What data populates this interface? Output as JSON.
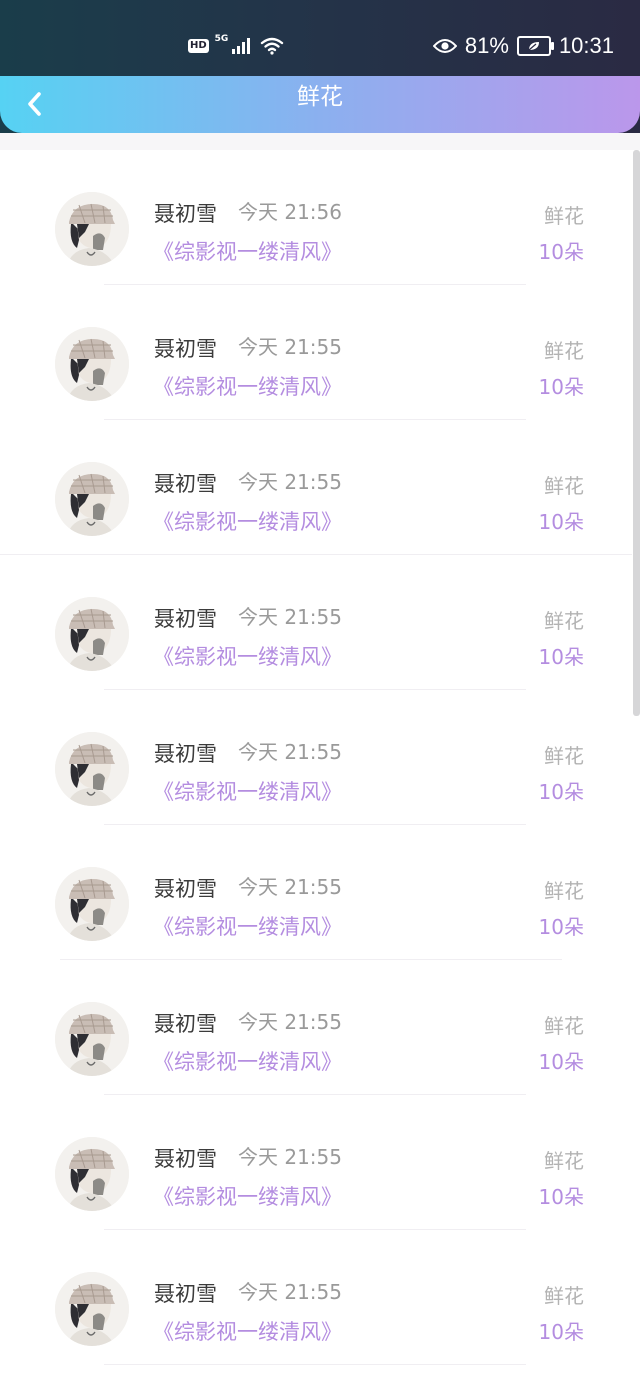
{
  "status_bar": {
    "hd_label": "HD",
    "network_label": "5G",
    "battery_percent": "81%",
    "time": "10:31",
    "icons": [
      "hd-icon",
      "signal-icon",
      "wifi-icon",
      "eye-icon",
      "battery-icon"
    ]
  },
  "header": {
    "title": "鲜花",
    "back_icon": "chevron-left-icon"
  },
  "colors": {
    "header_gradient_start": "#56d2f3",
    "header_gradient_end": "#bb97eb",
    "accent_purple": "#b48de0",
    "muted_gray": "#9a9a9a"
  },
  "records": [
    {
      "name": "聂初雪",
      "time": "今天 21:56",
      "work": "《综影视一缕清风》",
      "gift_type": "鲜花",
      "count": "10朵"
    },
    {
      "name": "聂初雪",
      "time": "今天 21:55",
      "work": "《综影视一缕清风》",
      "gift_type": "鲜花",
      "count": "10朵"
    },
    {
      "name": "聂初雪",
      "time": "今天 21:55",
      "work": "《综影视一缕清风》",
      "gift_type": "鲜花",
      "count": "10朵"
    },
    {
      "name": "聂初雪",
      "time": "今天 21:55",
      "work": "《综影视一缕清风》",
      "gift_type": "鲜花",
      "count": "10朵"
    },
    {
      "name": "聂初雪",
      "time": "今天 21:55",
      "work": "《综影视一缕清风》",
      "gift_type": "鲜花",
      "count": "10朵"
    },
    {
      "name": "聂初雪",
      "time": "今天 21:55",
      "work": "《综影视一缕清风》",
      "gift_type": "鲜花",
      "count": "10朵"
    },
    {
      "name": "聂初雪",
      "time": "今天 21:55",
      "work": "《综影视一缕清风》",
      "gift_type": "鲜花",
      "count": "10朵"
    },
    {
      "name": "聂初雪",
      "time": "今天 21:55",
      "work": "《综影视一缕清风》",
      "gift_type": "鲜花",
      "count": "10朵"
    },
    {
      "name": "聂初雪",
      "time": "今天 21:55",
      "work": "《综影视一缕清风》",
      "gift_type": "鲜花",
      "count": "10朵"
    }
  ]
}
